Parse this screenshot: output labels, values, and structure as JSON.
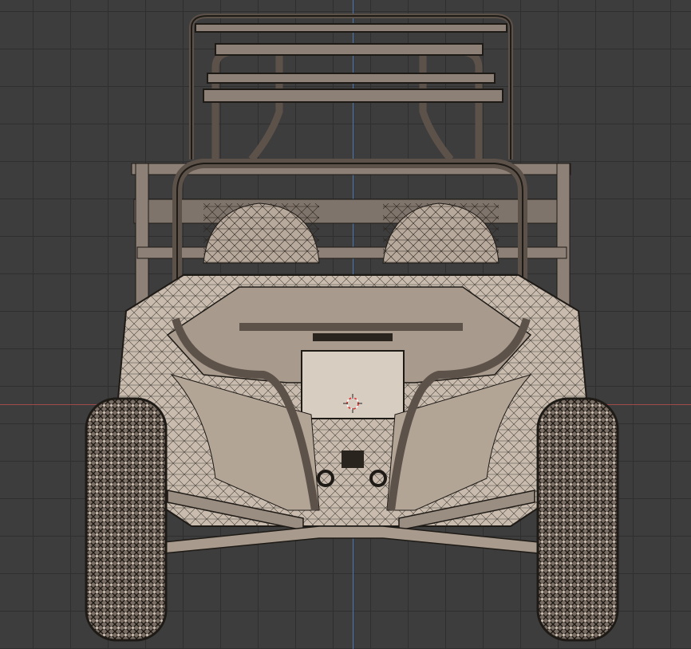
{
  "viewport": {
    "view_mode": "front-orthographic",
    "shading": "wireframe-overlay",
    "grid": true,
    "axes": [
      "x-axis-red",
      "z-axis-blue"
    ]
  },
  "model": {
    "subject": "utv-buggy",
    "colors": {
      "body": "#c9bcae",
      "shadow": "#8f8378",
      "wire": "#1c1815",
      "tire": "#6e635a"
    }
  },
  "cursor": {
    "icon": "3d-cursor-icon"
  }
}
